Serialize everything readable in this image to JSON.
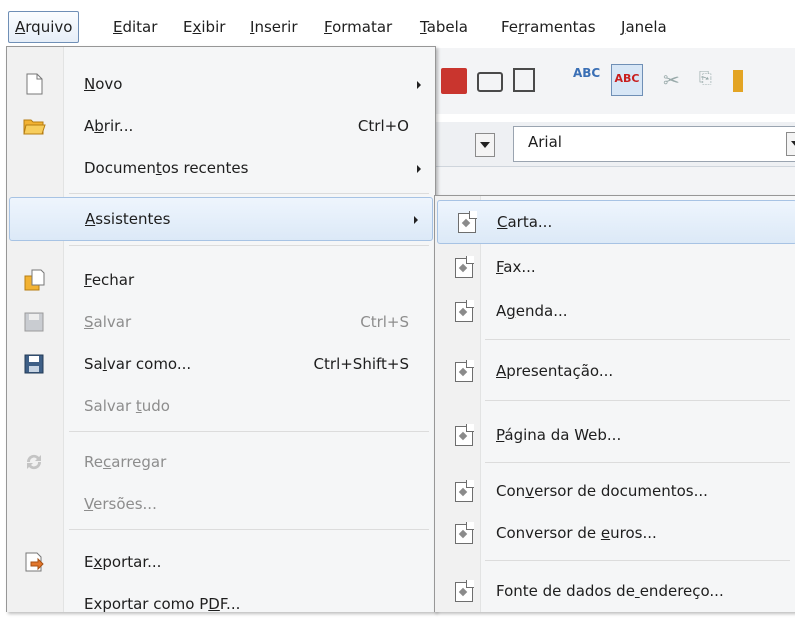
{
  "menubar": {
    "items": [
      {
        "label": "Arquivo",
        "u": 0
      },
      {
        "label": "Editar",
        "u": 0
      },
      {
        "label": "Exibir",
        "u": 1
      },
      {
        "label": "Inserir",
        "u": 0
      },
      {
        "label": "Formatar",
        "u": 0
      },
      {
        "label": "Tabela",
        "u": 0
      },
      {
        "label": "Ferramentas",
        "u": 2
      },
      {
        "label": "Janela",
        "u": 0
      }
    ]
  },
  "toolbar": {
    "font_name": "Arial"
  },
  "file_menu": {
    "items": [
      {
        "label": "Novo",
        "u": 0,
        "icon": "new-document-icon",
        "submenu": true
      },
      {
        "label": "Abrir...",
        "u": 1,
        "icon": "open-folder-icon",
        "accel": "Ctrl+O"
      },
      {
        "label": "Documentos recentes",
        "u": 7,
        "submenu": true
      },
      {
        "label": "Assistentes",
        "u": 0,
        "submenu": true,
        "hover": true
      },
      {
        "label": "Fechar",
        "u": 0,
        "icon": "close-document-icon"
      },
      {
        "label": "Salvar",
        "u": 0,
        "icon": "save-icon",
        "accel": "Ctrl+S",
        "disabled": true
      },
      {
        "label": "Salvar como...",
        "u": 2,
        "icon": "save-as-icon",
        "accel": "Ctrl+Shift+S"
      },
      {
        "label": "Salvar tudo",
        "u": 7,
        "disabled": true
      },
      {
        "label": "Recarregar",
        "u": 2,
        "icon": "reload-icon",
        "disabled": true
      },
      {
        "label": "Versões...",
        "u": 0,
        "disabled": true
      },
      {
        "label": "Exportar...",
        "u": 1,
        "icon": "export-icon"
      },
      {
        "label": "Exportar como PDF...",
        "u": 15
      }
    ]
  },
  "wizards_menu": {
    "items": [
      {
        "label": "Carta...",
        "u": 0,
        "hover": true
      },
      {
        "label": "Fax...",
        "u": 0
      },
      {
        "label": "Agenda...",
        "u": 1
      },
      {
        "label": "Apresentação...",
        "u": 0
      },
      {
        "label": "Página da Web...",
        "u": 0
      },
      {
        "label": "Conversor de documentos...",
        "u": 3
      },
      {
        "label": "Conversor de euros...",
        "u": 13
      },
      {
        "label": "Fonte de dados de endereço...",
        "u": 17
      }
    ]
  }
}
